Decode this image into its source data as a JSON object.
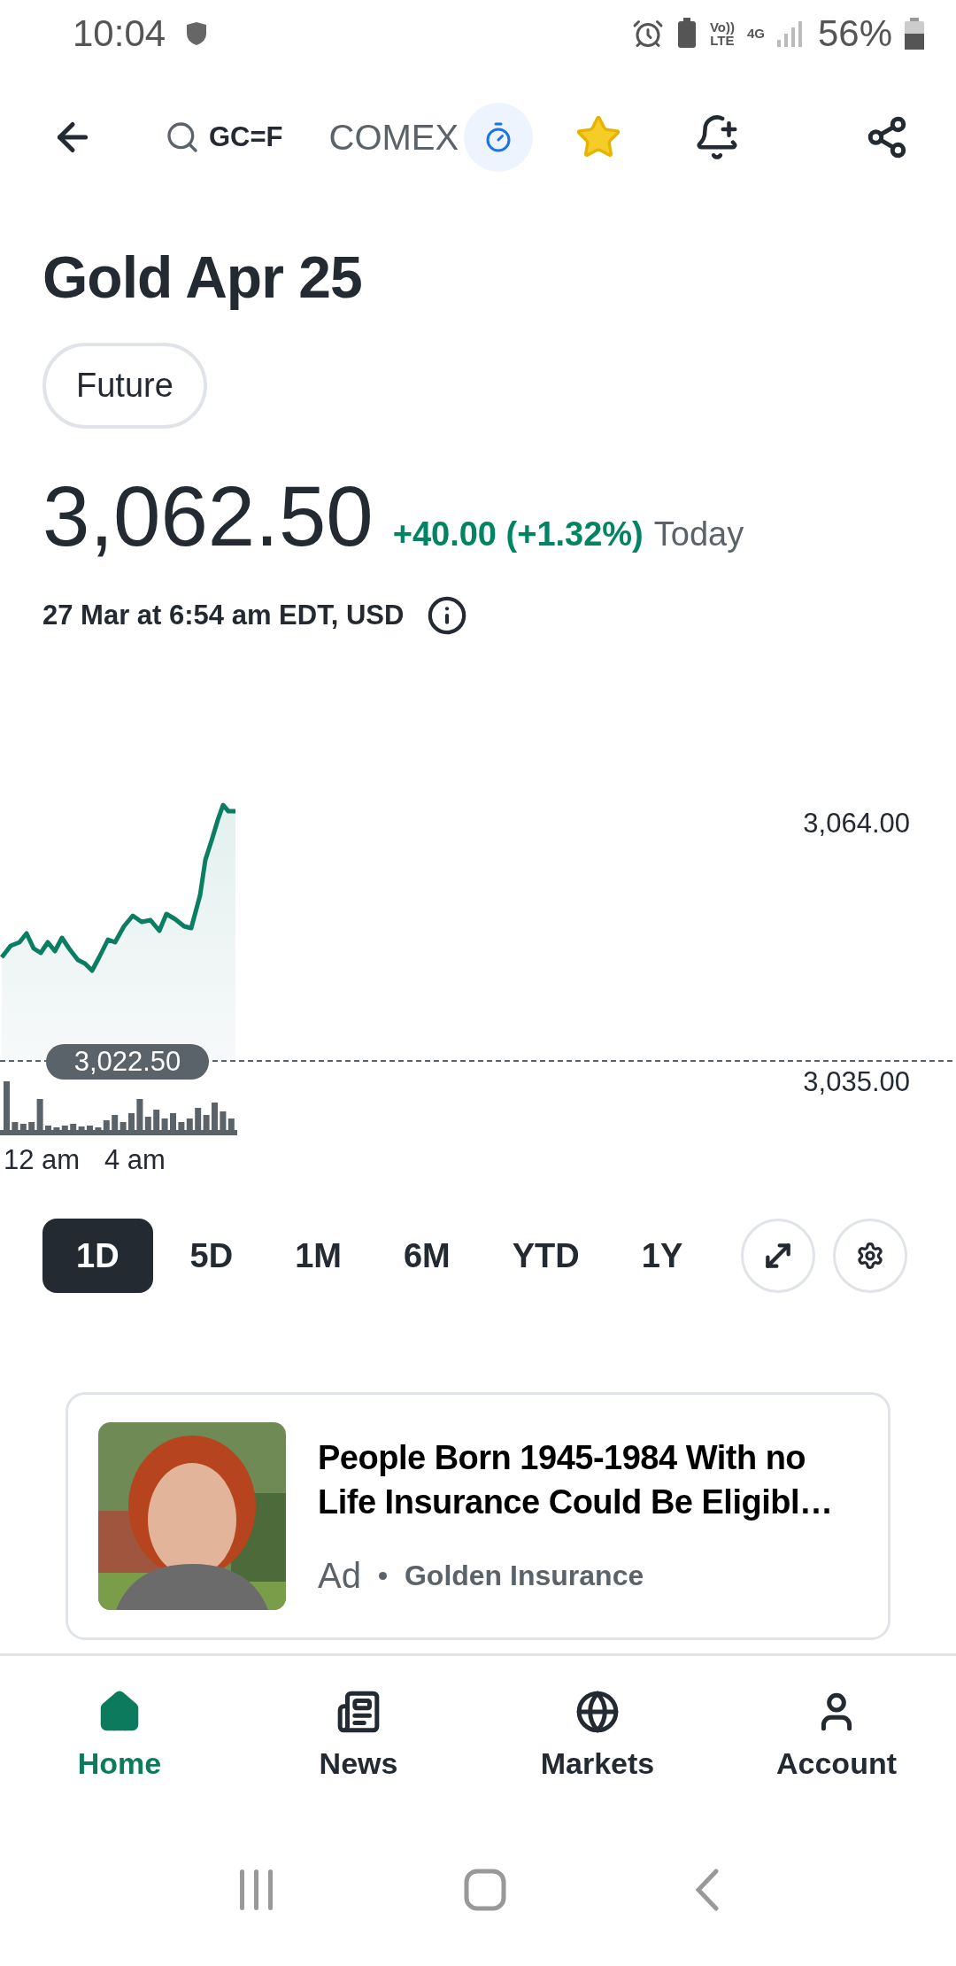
{
  "status_bar": {
    "time": "10:04",
    "network": "Vo))\nLTE",
    "data": "4G",
    "battery": "56%"
  },
  "toolbar": {
    "symbol": "GC=F",
    "exchange": "COMEX",
    "favorite": true
  },
  "title": "Gold Apr 25",
  "type_chip": "Future",
  "quote": {
    "price": "3,062.50",
    "change": "+40.00 (+1.32%)",
    "period": "Today"
  },
  "timestamp": "27 Mar at 6:54 am EDT, USD",
  "chart": {
    "price_labels": [
      "3,064.00",
      "3,035.00"
    ],
    "previous_close": "3,022.50",
    "time_labels": [
      "12 am",
      "4 am"
    ]
  },
  "ranges": [
    {
      "label": "1D",
      "selected": true
    },
    {
      "label": "5D",
      "selected": false
    },
    {
      "label": "1M",
      "selected": false
    },
    {
      "label": "6M",
      "selected": false
    },
    {
      "label": "YTD",
      "selected": false
    },
    {
      "label": "1Y",
      "selected": false
    }
  ],
  "ad": {
    "headline": "People Born 1945-1984 With no Life Insurance Could Be Eligibl…",
    "label": "Ad",
    "sponsor": "Golden Insurance"
  },
  "nav": [
    {
      "label": "Home",
      "selected": true
    },
    {
      "label": "News",
      "selected": false
    },
    {
      "label": "Markets",
      "selected": false
    },
    {
      "label": "Account",
      "selected": false
    }
  ]
}
